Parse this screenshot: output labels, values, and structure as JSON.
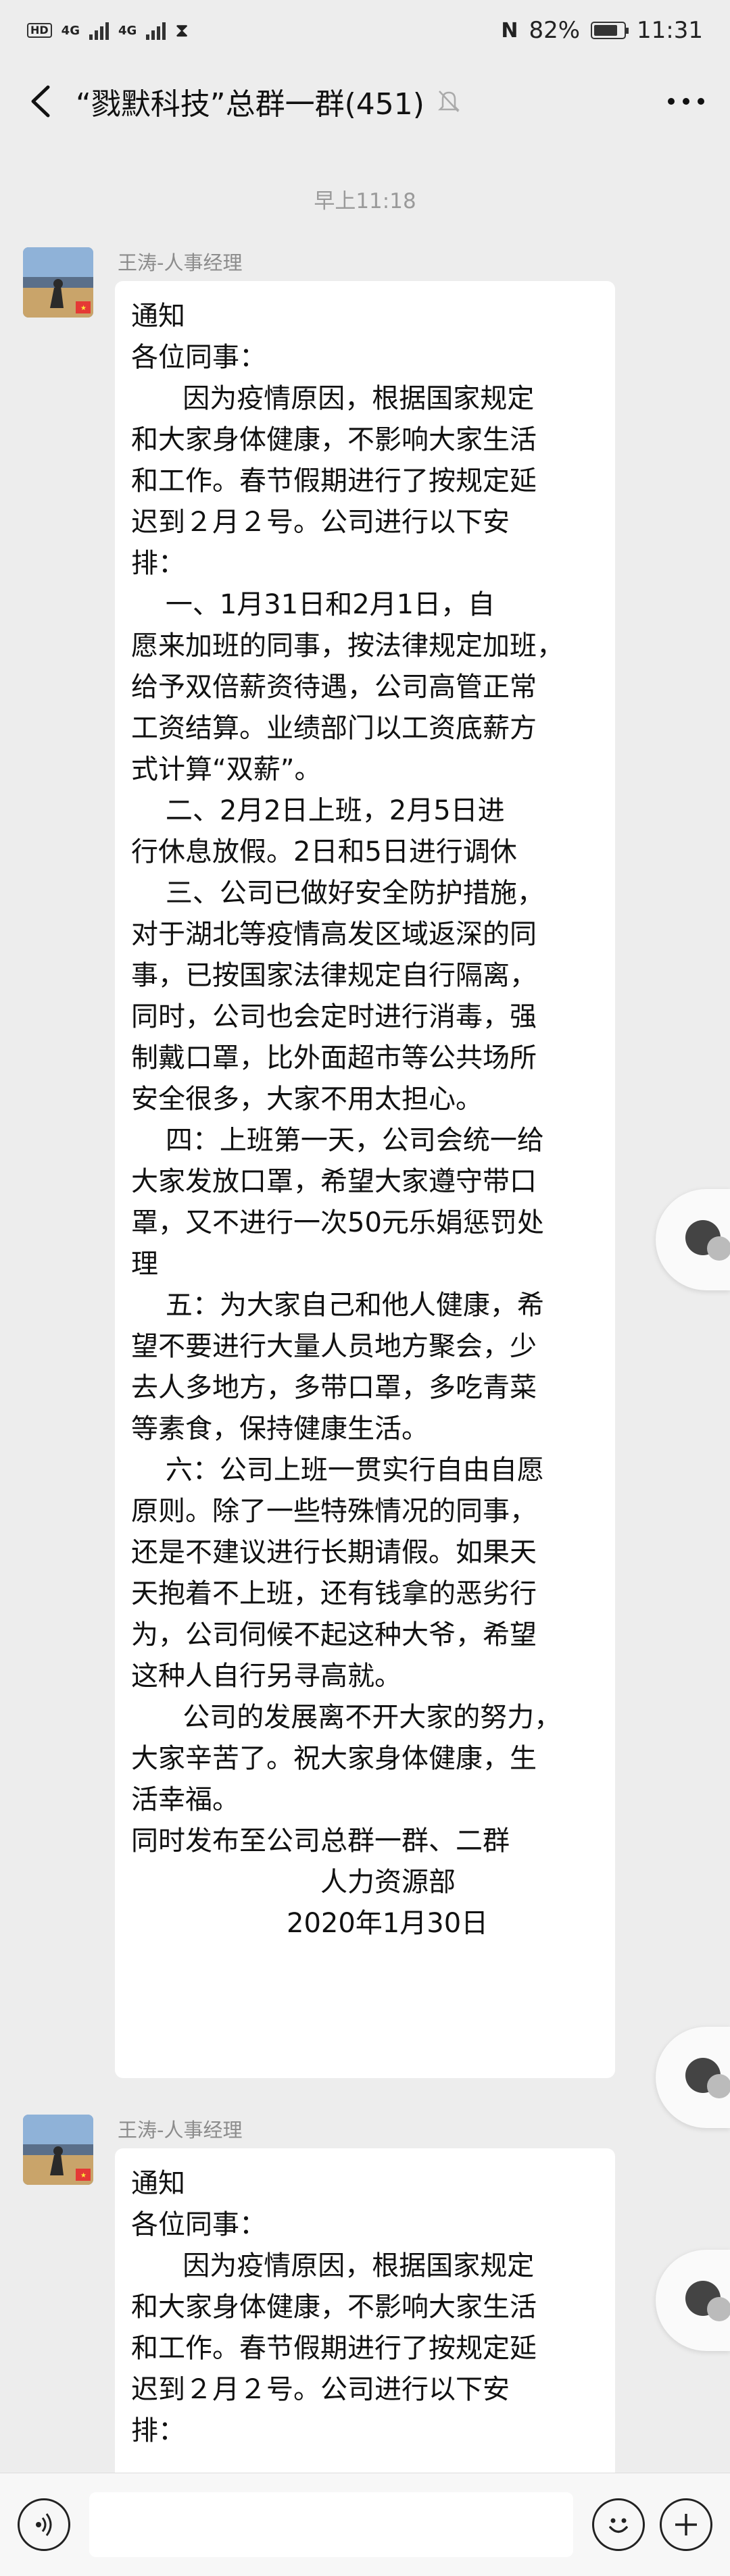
{
  "status_bar": {
    "hd1": "HD",
    "hd2": "HD",
    "signal1": "4G",
    "signal2": "4G",
    "battery": "82%",
    "time": "11:31"
  },
  "header": {
    "title": "“戮默科技”总群一群(451)"
  },
  "chat": {
    "time_label": "早上11:18",
    "messages": [
      {
        "sender": "王涛-人事经理",
        "lines": [
          "通知",
          "各位同事：",
          "      因为疫情原因，根据国家规定",
          "和大家身体健康，不影响大家生活",
          "和工作。春节假期进行了按规定延",
          "迟到２月２号。公司进行以下安",
          "排：",
          "    一、1月31日和2月1日，自",
          "愿来加班的同事，按法律规定加班，",
          "给予双倍薪资待遇，公司高管正常",
          "工资结算。业绩部门以工资底薪方",
          "式计算“双薪”。",
          "    二、2月2日上班，2月5日进",
          "行休息放假。2日和5日进行调休",
          "    三、公司已做好安全防护措施，",
          "对于湖北等疫情高发区域返深的同",
          "事，已按国家法律规定自行隔离，",
          "同时，公司也会定时进行消毒，强",
          "制戴口罩，比外面超市等公共场所",
          "安全很多，大家不用太担心。",
          "    四：上班第一天，公司会统一给",
          "大家发放口罩，希望大家遵守带口",
          "罩，又不进行一次50元乐娟惩罚处",
          "理",
          "    五：为大家自己和他人健康，希",
          "望不要进行大量人员地方聚会，少",
          "去人多地方，多带口罩，多吃青菜",
          "等素食，保持健康生活。",
          "    六：公司上班一贯实行自由自愿",
          "原则。除了一些特殊情况的同事，",
          "还是不建议进行长期请假。如果天",
          "天抱着不上班，还有钱拿的恶劣行",
          "为，公司伺候不起这种大爷，希望",
          "这种人自行另寻高就。",
          "      公司的发展离不开大家的努力，",
          "大家辛苦了。祝大家身体健康，生",
          "活幸福。",
          "同时发布至公司总群一群、二群"
        ],
        "sign_dept": "人力资源部",
        "sign_date": "2020年1月30日"
      },
      {
        "sender": "王涛-人事经理",
        "lines": [
          "通知",
          "各位同事：",
          "      因为疫情原因，根据国家规定",
          "和大家身体健康，不影响大家生活",
          "和工作。春节假期进行了按规定延",
          "迟到２月２号。公司进行以下安",
          "排："
        ]
      }
    ]
  },
  "input": {
    "placeholder": ""
  },
  "icons": {
    "back": "back-arrow-icon",
    "mute": "bell-mute-icon",
    "more": "more-dots-icon",
    "voice": "voice-icon",
    "emoji": "emoji-icon",
    "add": "plus-icon"
  }
}
